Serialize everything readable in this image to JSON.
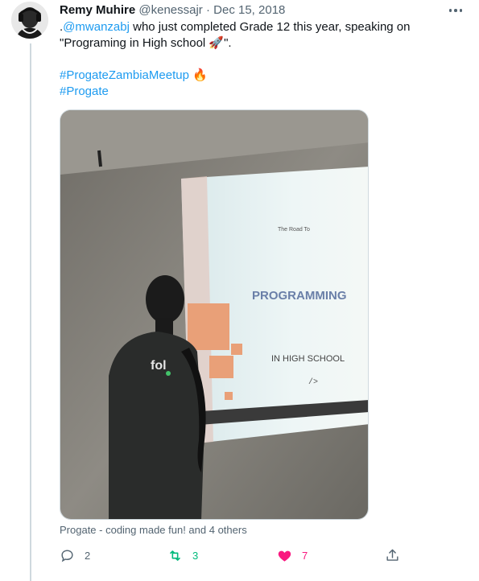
{
  "tweet": {
    "author_name": "Remy Muhire",
    "author_handle": "@kenessajr",
    "separator": "·",
    "date": "Dec 15, 2018",
    "text_prefix": ".",
    "mention": "@mwanzabj",
    "text_line1_rest": " who just completed Grade 12 this year, speaking on",
    "text_line2": "\"Programing in High school 🚀\".",
    "hashtag1": "#ProgateZambiaMeetup",
    "hashtag1_emoji": "🔥",
    "hashtag2": "#Progate"
  },
  "media": {
    "slide_top": "The Road To",
    "slide_title": "PROGRAMMING",
    "slide_subtitle": "IN HIGH SCHOOL",
    "slide_mark": "/>",
    "shirt_text": "fol"
  },
  "tagged_text": "Progate - coding made fun! and 4 others",
  "actions": {
    "reply_count": "2",
    "retweet_count": "3",
    "like_count": "7"
  },
  "colors": {
    "link": "#1d9bf0",
    "retweet": "#00ba7c",
    "like": "#f91880",
    "muted": "#536471"
  },
  "icons": [
    "more-icon",
    "reply-icon",
    "retweet-icon",
    "heart-icon",
    "share-icon"
  ]
}
